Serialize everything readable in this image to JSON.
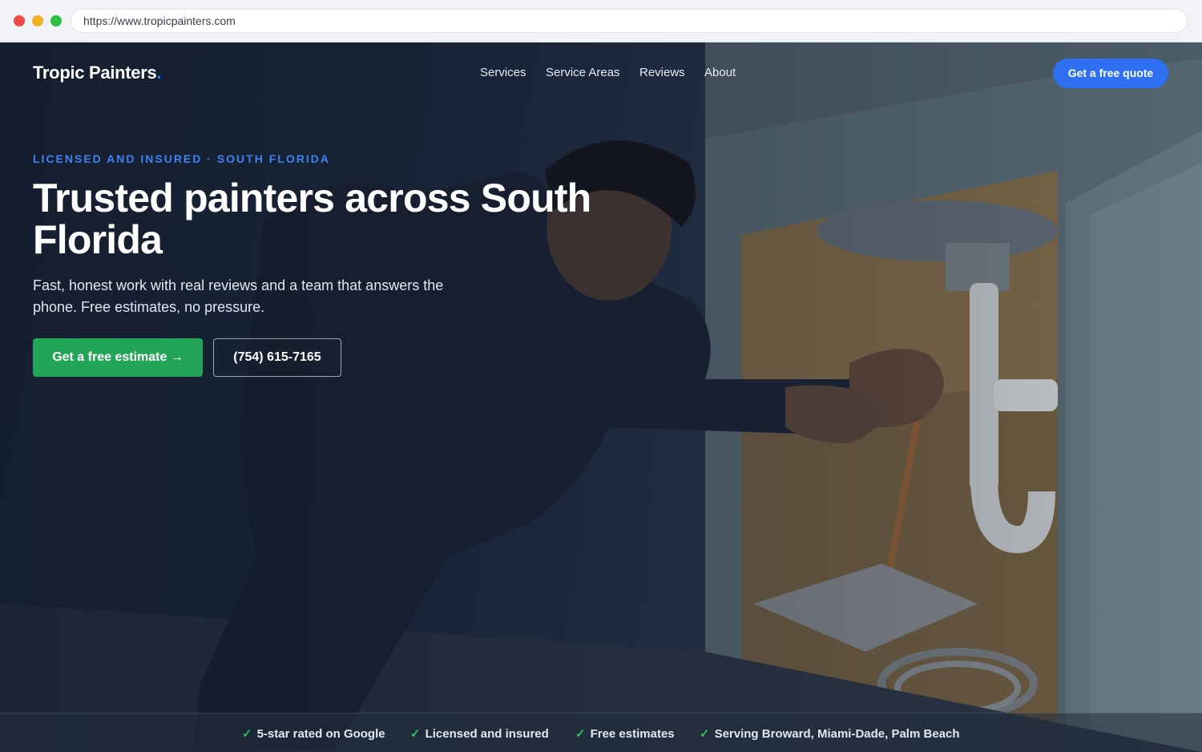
{
  "browser": {
    "url": "https://www.tropicpainters.com"
  },
  "header": {
    "logo_text": "Tropic Painters",
    "logo_dot": ".",
    "nav": [
      {
        "label": "Services"
      },
      {
        "label": "Service Areas"
      },
      {
        "label": "Reviews"
      },
      {
        "label": "About"
      }
    ],
    "cta_label": "Get a free quote"
  },
  "hero": {
    "eyebrow": "LICENSED AND INSURED · SOUTH FLORIDA",
    "headline": "Trusted painters across South Florida",
    "subheadline": "Fast, honest work with real reviews and a team that answers the phone. Free estimates, no pressure.",
    "primary_button": "Get a free estimate →",
    "phone_button": "(754) 615-7165"
  },
  "trust_bar": {
    "check_glyph": "✓",
    "items": [
      {
        "label": "5-star rated on Google"
      },
      {
        "label": "Licensed and insured"
      },
      {
        "label": "Free estimates"
      },
      {
        "label": "Serving Broward, Miami-Dade, Palm Beach"
      }
    ]
  },
  "colors": {
    "accent_blue": "#2f6ff2",
    "eyebrow_blue": "#3d82f2",
    "cta_green": "#22a557",
    "check_green": "#2fbf5e"
  }
}
